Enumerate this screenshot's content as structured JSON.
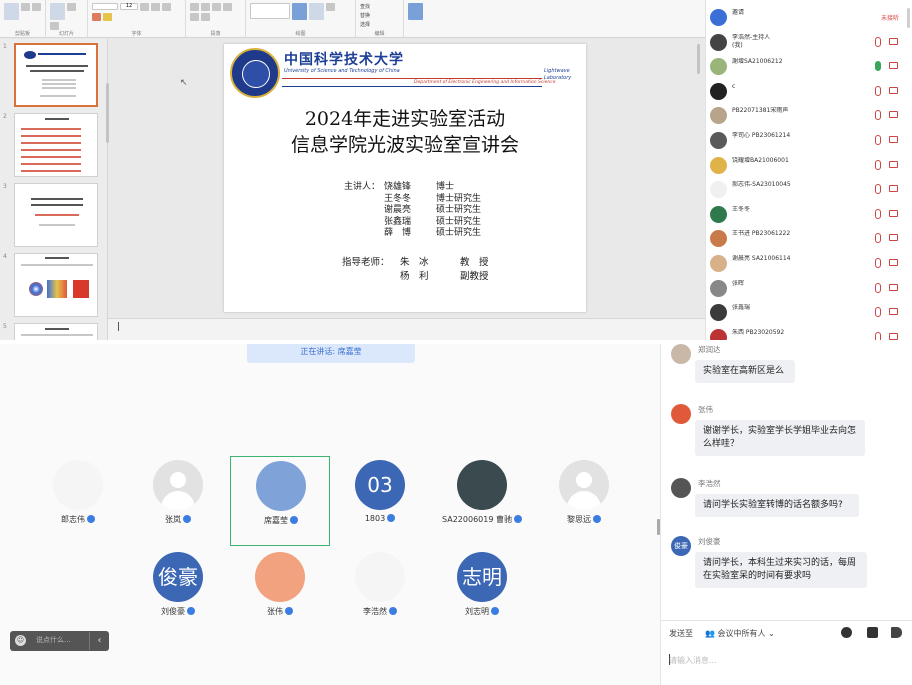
{
  "ppt": {
    "ribbon": {
      "group_labels": [
        "剪贴板",
        "幻灯片",
        "字体",
        "段落",
        "绘图",
        "编辑"
      ],
      "font_size": "12",
      "edit_labels": [
        "查找",
        "替换",
        "选择"
      ]
    },
    "thumbnails": [
      {
        "num": "1",
        "title": "2024年走进实验室活动"
      },
      {
        "num": "2",
        "title": "目录"
      },
      {
        "num": "3",
        "title": "2024年走进实验室活动"
      },
      {
        "num": "4",
        "title": ""
      },
      {
        "num": "5",
        "title": ""
      }
    ],
    "slide": {
      "uni_cn": "中国科学技术大学",
      "uni_en": "University of Science and Technology of China",
      "dept": "Department of Electronic Engineering and Information Science",
      "lab_logo": "Lightwave Laboratory",
      "title_line1": "2024年走进实验室活动",
      "title_line2": "信息学院光波实验室宣讲会",
      "presenters_label": "主讲人：",
      "presenters": [
        {
          "name": "饶雄锋",
          "role": "博士"
        },
        {
          "name": "王冬冬",
          "role": "博士研究生"
        },
        {
          "name": "谢晨亮",
          "role": "硕士研究生"
        },
        {
          "name": "张鑫瑞",
          "role": "硕士研究生"
        },
        {
          "name": "薛　博",
          "role": "硕士研究生"
        }
      ],
      "advisors_label": "指导老师：",
      "advisors": [
        {
          "name": "朱　冰",
          "role": "教　授"
        },
        {
          "name": "杨　利",
          "role": "副教授"
        }
      ]
    }
  },
  "participants": {
    "items": [
      {
        "name": "邀请",
        "status": "未接听",
        "avatar": "#3b6fd8"
      },
      {
        "name": "李浩然-主持人\n(我)",
        "status": "",
        "avatar": "#444"
      },
      {
        "name": "謝增SA21006212",
        "status": "",
        "avatar": "#9ab57a"
      },
      {
        "name": "c",
        "status": "",
        "avatar": "#222"
      },
      {
        "name": "PB22071381宋雨声",
        "status": "",
        "avatar": "#b8a48a"
      },
      {
        "name": "李司心 PB23061214",
        "status": "",
        "avatar": "#5a5a5a"
      },
      {
        "name": "饶耀增BA21006001",
        "status": "",
        "avatar": "#e0b24a"
      },
      {
        "name": "郝志伟-SA23010045",
        "status": "",
        "avatar": "#f0f0f0"
      },
      {
        "name": "王冬冬",
        "status": "",
        "avatar": "#2f7a4d"
      },
      {
        "name": "王书进 PB23061222",
        "status": "",
        "avatar": "#c97a4a"
      },
      {
        "name": "谢晨亮 SA21006114",
        "status": "",
        "avatar": "#d8b08a"
      },
      {
        "name": "张晖",
        "status": "",
        "avatar": "#888"
      },
      {
        "name": "张鑫瑞",
        "status": "",
        "avatar": "#3b3b3b"
      },
      {
        "name": "朱西 PB23020592",
        "status": "",
        "avatar": "#b33"
      }
    ]
  },
  "meeting": {
    "speaking": "正在讲话: 席嘉莹",
    "tiles": [
      {
        "name": "郎志伟",
        "avatar_text": "",
        "style": "cartoon"
      },
      {
        "name": "张岚",
        "avatar_text": "",
        "style": "gray"
      },
      {
        "name": "席嘉莹",
        "avatar_text": "",
        "style": "orange"
      },
      {
        "name": "1803",
        "avatar_text": "03",
        "style": "blue"
      },
      {
        "name": "SA22006019 曹驰",
        "avatar_text": "",
        "style": "game"
      },
      {
        "name": "黎思远",
        "avatar_text": "",
        "style": "gray"
      },
      {
        "name": "刘俊豪",
        "avatar_text": "俊豪",
        "style": "blue"
      },
      {
        "name": "张伟",
        "avatar_text": "",
        "style": "photo"
      },
      {
        "name": "李浩然",
        "avatar_text": "",
        "style": "cartoon"
      },
      {
        "name": "刘志明",
        "avatar_text": "志明",
        "style": "blue"
      }
    ],
    "chat_placeholder": "说点什么...",
    "collapse_icon": "‹"
  },
  "chat": {
    "messages": [
      {
        "name": "郑润达",
        "text": "实验室在高新区是么",
        "avatar": "#c9b8a8"
      },
      {
        "name": "张伟",
        "text": "谢谢学长，实验室学长学姐毕业去向怎么样哇？",
        "avatar": "#e05a3a"
      },
      {
        "name": "李浩然",
        "text": "请问学长实验室转博的话名额多吗?",
        "avatar": "#555"
      },
      {
        "name": "刘俊豪",
        "text": "请问学长，本科生过来实习的话，每周在实验室呆的时间有要求吗",
        "avatar": "#3b67b5",
        "avatar_text": "俊豪"
      }
    ],
    "send_to_label": "发送至",
    "send_to_target": "会议中所有人",
    "input_placeholder": "请输入消息..."
  }
}
